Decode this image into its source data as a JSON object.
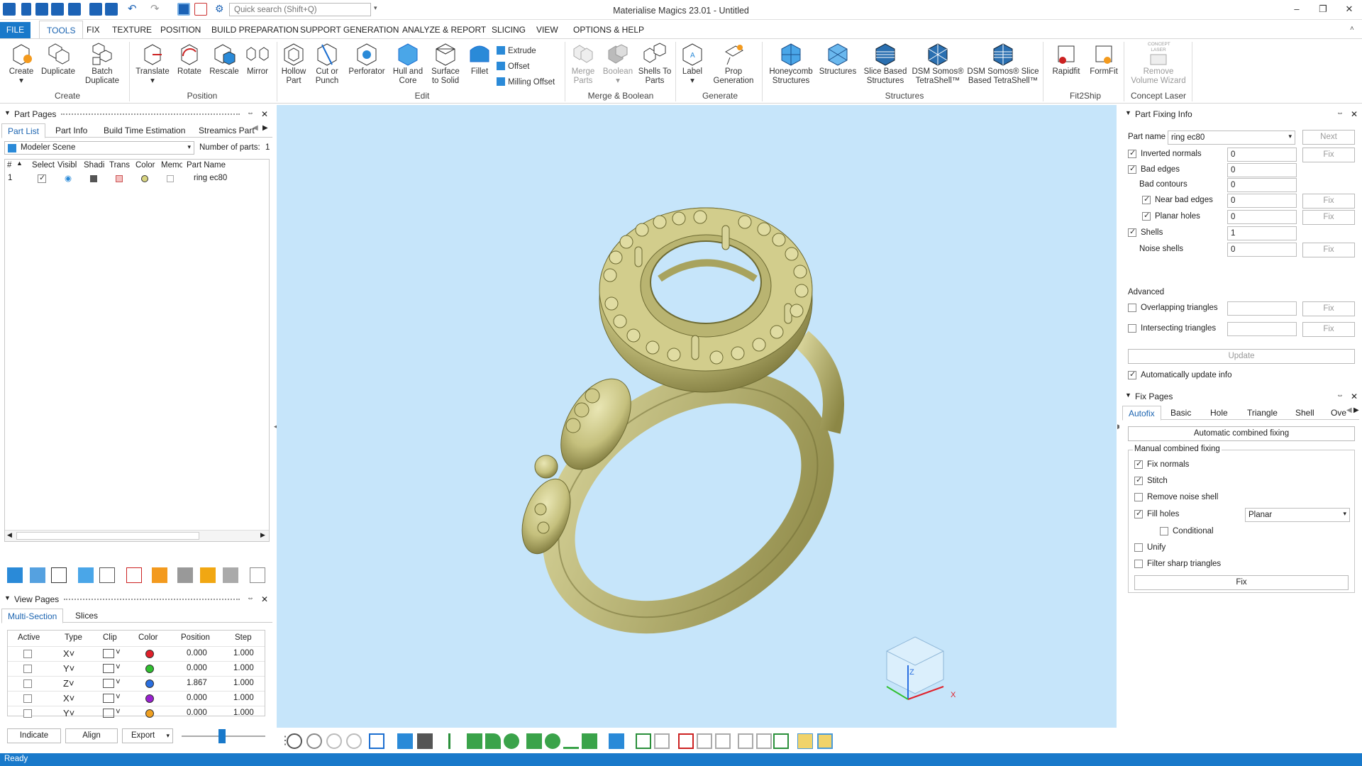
{
  "window": {
    "title": "Materialise Magics 23.01 - Untitled",
    "search_placeholder": "Quick search (Shift+Q)"
  },
  "menu": [
    "FILE",
    "TOOLS",
    "FIX",
    "TEXTURE",
    "POSITION",
    "BUILD PREPARATION",
    "SUPPORT GENERATION",
    "ANALYZE & REPORT",
    "SLICING",
    "VIEW",
    "OPTIONS & HELP"
  ],
  "ribbon": {
    "create": {
      "create": "Create",
      "duplicate": "Duplicate",
      "batch": "Batch Duplicate",
      "group": "Create"
    },
    "position": {
      "translate": "Translate",
      "rotate": "Rotate",
      "rescale": "Rescale",
      "mirror": "Mirror",
      "group": "Position"
    },
    "edit": {
      "hollow": "Hollow Part",
      "cut": "Cut or Punch",
      "perforator": "Perforator",
      "hull": "Hull and Core",
      "surface": "Surface to Solid",
      "fillet": "Fillet",
      "extrude": "Extrude",
      "offset": "Offset",
      "milling": "Milling Offset",
      "group": "Edit"
    },
    "merge": {
      "merge": "Merge Parts",
      "boolean": "Boolean",
      "shells": "Shells To Parts",
      "group": "Merge & Boolean"
    },
    "generate": {
      "label": "Label",
      "prop": "Prop Generation",
      "group": "Generate"
    },
    "structures": {
      "honeycomb": "Honeycomb Structures",
      "structures": "Structures",
      "slice": "Slice Based Structures",
      "dsm": "DSM Somos® TetraShell™",
      "dsm_slice": "DSM Somos® Slice Based TetraShell™",
      "group": "Structures"
    },
    "fit2ship": {
      "rapidfit": "Rapidfit",
      "formfit": "FormFit",
      "group": "Fit2Ship"
    },
    "laser": {
      "icon_text": "CONCEPT LASER",
      "remove": "Remove Volume Wizard",
      "group": "Concept Laser"
    }
  },
  "part_pages": {
    "title": "Part Pages",
    "tabs": [
      "Part List",
      "Part Info",
      "Build Time Estimation",
      "Streamics Part"
    ],
    "scene": "Modeler Scene",
    "num_parts_label": "Number of parts:",
    "num_parts": "1",
    "columns": [
      "#",
      "Select",
      "Visibl",
      "Shadi",
      "Trans",
      "Color",
      "Memo",
      "Part Name"
    ],
    "rows": [
      {
        "n": "1",
        "name": "ring ec80"
      }
    ]
  },
  "view_pages": {
    "title": "View Pages",
    "tabs": [
      "Multi-Section",
      "Slices"
    ],
    "columns": [
      "Active",
      "Type",
      "Clip",
      "Color",
      "Position",
      "Step"
    ],
    "rows": [
      {
        "type": "X",
        "color": "#e0202a",
        "position": "0.000",
        "step": "1.000"
      },
      {
        "type": "Y",
        "color": "#30c030",
        "position": "0.000",
        "step": "1.000"
      },
      {
        "type": "Z",
        "color": "#2a6fe0",
        "position": "1.867",
        "step": "1.000"
      },
      {
        "type": "X",
        "color": "#9a20d0",
        "position": "0.000",
        "step": "1.000"
      },
      {
        "type": "Y",
        "color": "#f0a020",
        "position": "0.000",
        "step": "1.000"
      }
    ],
    "buttons": {
      "indicate": "Indicate",
      "align": "Align",
      "export": "Export"
    }
  },
  "fixing_info": {
    "title": "Part Fixing Info",
    "part_name_label": "Part name",
    "part_name": "ring ec80",
    "next": "Next",
    "rows": [
      {
        "label": "Inverted normals",
        "value": "0",
        "fix": "Fix"
      },
      {
        "label": "Bad edges",
        "value": "0"
      },
      {
        "label": "Bad contours",
        "value": "0"
      },
      {
        "label": "Near bad edges",
        "value": "0",
        "fix": "Fix"
      },
      {
        "label": "Planar holes",
        "value": "0",
        "fix": "Fix"
      },
      {
        "label": "Shells",
        "value": "1"
      },
      {
        "label": "Noise shells",
        "value": "0",
        "fix": "Fix"
      }
    ],
    "advanced": "Advanced",
    "overlapping": "Overlapping triangles",
    "intersecting": "Intersecting triangles",
    "fix": "Fix",
    "update": "Update",
    "auto_update": "Automatically update info"
  },
  "fix_pages": {
    "title": "Fix Pages",
    "tabs": [
      "Autofix",
      "Basic",
      "Hole",
      "Triangle",
      "Shell",
      "Over"
    ],
    "auto_combined": "Automatic combined fixing",
    "manual": "Manual combined fixing",
    "fix_normals": "Fix normals",
    "stitch": "Stitch",
    "remove_noise": "Remove noise shell",
    "fill_holes": "Fill holes",
    "fill_mode": "Planar",
    "conditional": "Conditional",
    "unify": "Unify",
    "filter": "Filter sharp triangles",
    "fix": "Fix"
  },
  "axis": {
    "z": "Z",
    "x": "X"
  },
  "status": "Ready"
}
